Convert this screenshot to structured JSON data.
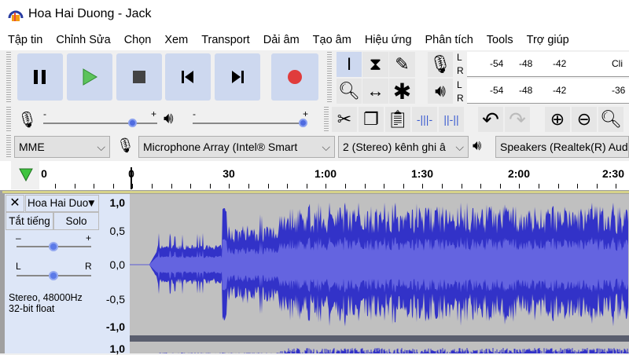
{
  "window": {
    "title": "Hoa Hai Duong - Jack"
  },
  "menu": [
    "Tập tin",
    "Chỉnh Sửa",
    "Chọn",
    "Xem",
    "Transport",
    "Dải âm",
    "Tạo âm",
    "Hiệu ứng",
    "Phân tích",
    "Tools",
    "Trợ giúp"
  ],
  "transport": {
    "buttons": [
      "pause",
      "play",
      "stop",
      "skip-to-start",
      "skip-to-end",
      "record"
    ],
    "record_color": "#e03c3c",
    "play_color": "#5cc35c"
  },
  "meters": {
    "record": {
      "labels": [
        "-54",
        "-48",
        "-42",
        "Cli"
      ]
    },
    "playback": {
      "labels": [
        "-54",
        "-48",
        "-42",
        "-36"
      ]
    },
    "channels": [
      "L",
      "R"
    ]
  },
  "mixer": {
    "record_volume": 0.9,
    "playback_volume": 1.0,
    "minus": "-",
    "plus": "+"
  },
  "devices": {
    "host": "MME",
    "input": "Microphone Array (Intel® Smart",
    "channels": "2 (Stereo) kênh ghi â",
    "output": "Speakers (Realtek(R) Audi"
  },
  "timeline": {
    "ticks": [
      "0",
      "0",
      "30",
      "1:00",
      "1:30",
      "2:00",
      "2:30"
    ]
  },
  "track": {
    "name": "Hoa Hai Duo",
    "mute": "Tắt tiếng",
    "solo": "Solo",
    "gain_minus": "–",
    "gain_plus": "+",
    "pan_left": "L",
    "pan_right": "R",
    "gain": 0.5,
    "pan": 0.5,
    "info1": "Stereo, 48000Hz",
    "info2": "32-bit float",
    "ruler": [
      "1,0",
      "0,5",
      "0,0",
      "-0,5",
      "-1,0",
      "1,0"
    ],
    "wave_color": "#3232c8",
    "rms_color": "#6464e0"
  }
}
